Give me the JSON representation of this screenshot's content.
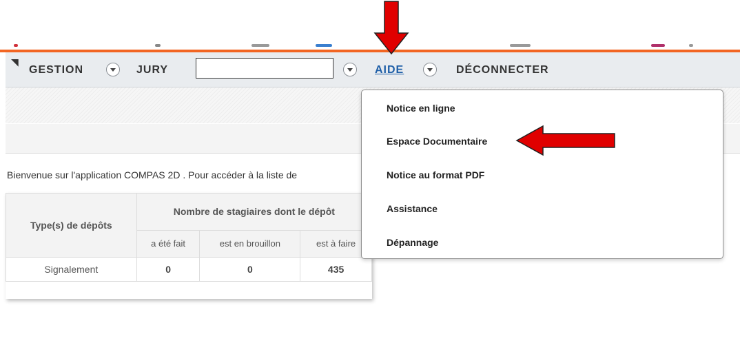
{
  "nav": {
    "items": [
      {
        "label": "GESTION"
      },
      {
        "label": "JURY"
      },
      {
        "label": "AIDE"
      },
      {
        "label": "DÉCONNECTER"
      }
    ],
    "search_value": ""
  },
  "welcome_text": "Bienvenue sur l'application COMPAS 2D . Pour accéder à la liste de",
  "table": {
    "row_header": "Type(s) de dépôts",
    "group_header": "Nombre de stagiaires dont le dépôt",
    "sub_headers": [
      "a été fait",
      "est en brouillon",
      "est à faire"
    ],
    "rows": [
      {
        "type": "Signalement",
        "values": [
          "0",
          "0",
          "435"
        ]
      }
    ]
  },
  "help_menu": {
    "items": [
      {
        "label": "Notice en ligne"
      },
      {
        "label": "Espace Documentaire"
      },
      {
        "label": "Notice au format PDF"
      },
      {
        "label": "Assistance"
      },
      {
        "label": "Dépannage"
      }
    ]
  },
  "colors": {
    "accent_orange": "#f26522",
    "link_blue": "#1f5fa8",
    "annotation_red": "#e00000"
  },
  "icons": [
    "chevron-down-icon",
    "red-arrow-down-icon",
    "red-arrow-left-icon"
  ]
}
